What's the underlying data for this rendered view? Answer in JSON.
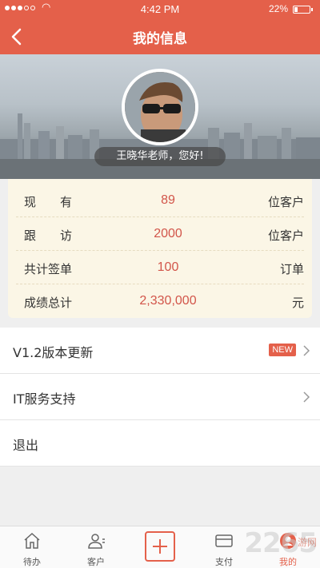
{
  "status_bar": {
    "time": "4:42 PM",
    "battery_text": "22%",
    "battery_level": 0.22
  },
  "nav": {
    "title": "我的信息"
  },
  "profile": {
    "greeting": "王晓华老师，您好!"
  },
  "stats": [
    {
      "label": "现　　有",
      "value": "89",
      "unit": "位客户"
    },
    {
      "label": "跟　　访",
      "value": "2000",
      "unit": "位客户"
    },
    {
      "label": "共计签单",
      "value": "100",
      "unit": "订单"
    },
    {
      "label": "成绩总计",
      "value": "2,330,000",
      "unit": "元"
    }
  ],
  "menu": {
    "update_label": "V1.2版本更新",
    "new_badge": "NEW",
    "it_support_label": "IT服务支持",
    "logout_label": "退出"
  },
  "tabs": {
    "todo": "待办",
    "clients": "客户",
    "pay": "支付",
    "mine": "我的"
  },
  "watermark": {
    "text": "2265",
    "sub": "游网"
  },
  "colors": {
    "accent": "#e4604a",
    "value": "#d2554a",
    "stats_bg": "#fbf6e6"
  }
}
